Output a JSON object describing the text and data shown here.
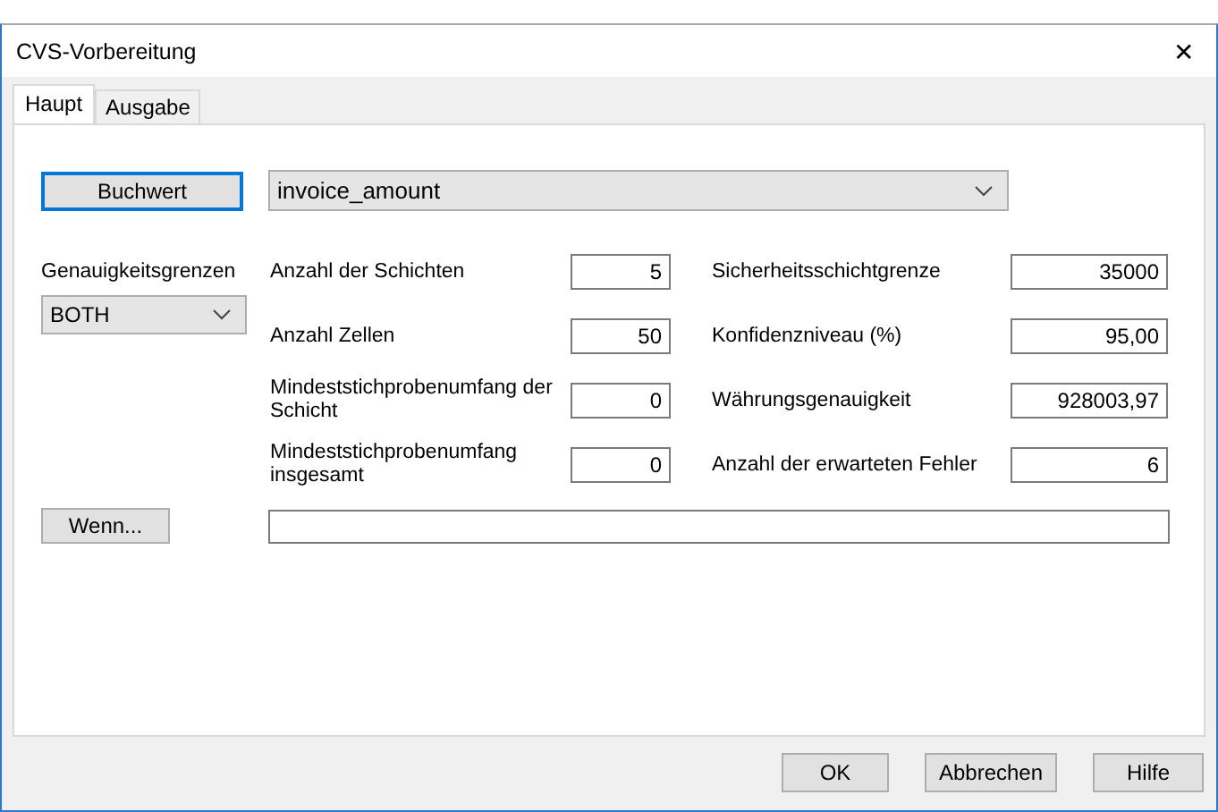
{
  "window": {
    "title": "CVS-Vorbereitung",
    "close": "✕"
  },
  "tabs": [
    {
      "label": "Haupt",
      "selected": true
    },
    {
      "label": "Ausgabe",
      "selected": false
    }
  ],
  "value_button": {
    "label": "Buchwert",
    "focused": true
  },
  "value_field": {
    "value": "invoice_amount"
  },
  "precision_limits": {
    "label": "Genauigkeitsgrenzen",
    "value": "BOTH"
  },
  "fields_left": [
    {
      "label": "Anzahl der Schichten",
      "value": "5"
    },
    {
      "label": "Anzahl Zellen",
      "value": "50"
    },
    {
      "label": "Mindeststichprobenumfang der Schicht",
      "value": "0"
    },
    {
      "label": "Mindeststichprobenumfang insgesamt",
      "value": "0"
    }
  ],
  "fields_right": [
    {
      "label": "Sicherheitsschichtgrenze",
      "value": "35000"
    },
    {
      "label": "Konfidenzniveau (%)",
      "value": "95,00"
    },
    {
      "label": "Währungsgenauigkeit",
      "value": "928003,97"
    },
    {
      "label": "Anzahl der erwarteten Fehler",
      "value": "6"
    }
  ],
  "if_button": {
    "label": "Wenn...",
    "focused": false
  },
  "buttons": [
    "OK",
    "Abbrechen",
    "Hilfe"
  ]
}
